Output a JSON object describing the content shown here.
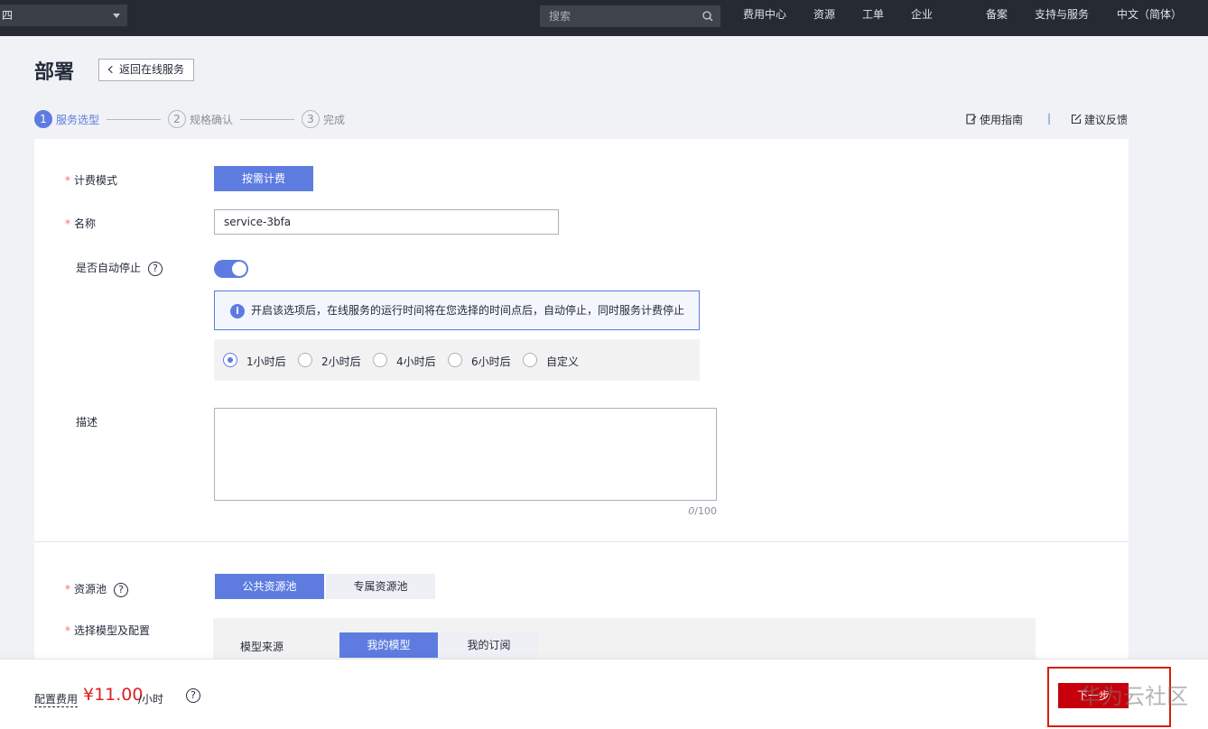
{
  "topbar": {
    "region_label": "四",
    "search_placeholder": "搜索",
    "nav": [
      "费用中心",
      "资源",
      "工单",
      "企业",
      "备案",
      "支持与服务",
      "中文（简体）"
    ]
  },
  "header": {
    "title": "部署",
    "back_label": "返回在线服务"
  },
  "steps": [
    {
      "num": "1",
      "label": "服务选型"
    },
    {
      "num": "2",
      "label": "规格确认"
    },
    {
      "num": "3",
      "label": "完成"
    }
  ],
  "links": {
    "guide": "使用指南",
    "feedback": "建议反馈"
  },
  "form": {
    "billing": {
      "label": "计费模式",
      "option": "按需计费"
    },
    "name": {
      "label": "名称",
      "value": "service-3bfa"
    },
    "autostop": {
      "label": "是否自动停止",
      "enabled": true,
      "info": "开启该选项后，在线服务的运行时间将在您选择的时间点后，自动停止，同时服务计费停止",
      "options": [
        "1小时后",
        "2小时后",
        "4小时后",
        "6小时后",
        "自定义"
      ],
      "selected": "1小时后"
    },
    "description": {
      "label": "描述",
      "value": "",
      "count": "0",
      "max": "/100"
    },
    "pool": {
      "label": "资源池",
      "options": [
        "公共资源池",
        "专属资源池"
      ],
      "selected": "公共资源池"
    },
    "model": {
      "label": "选择模型及配置",
      "source_label": "模型来源",
      "options": [
        "我的模型",
        "我的订阅"
      ],
      "selected": "我的模型"
    }
  },
  "footer": {
    "cost_label": "配置费用",
    "cost_value": "¥11.00",
    "cost_unit": "/小时",
    "next_label": "下一步",
    "watermark": "华为云社区"
  },
  "colors": {
    "accent": "#5e7ce0",
    "primary_red": "#c7000b",
    "price_red": "#e02020",
    "topbar_bg": "#262b33"
  }
}
